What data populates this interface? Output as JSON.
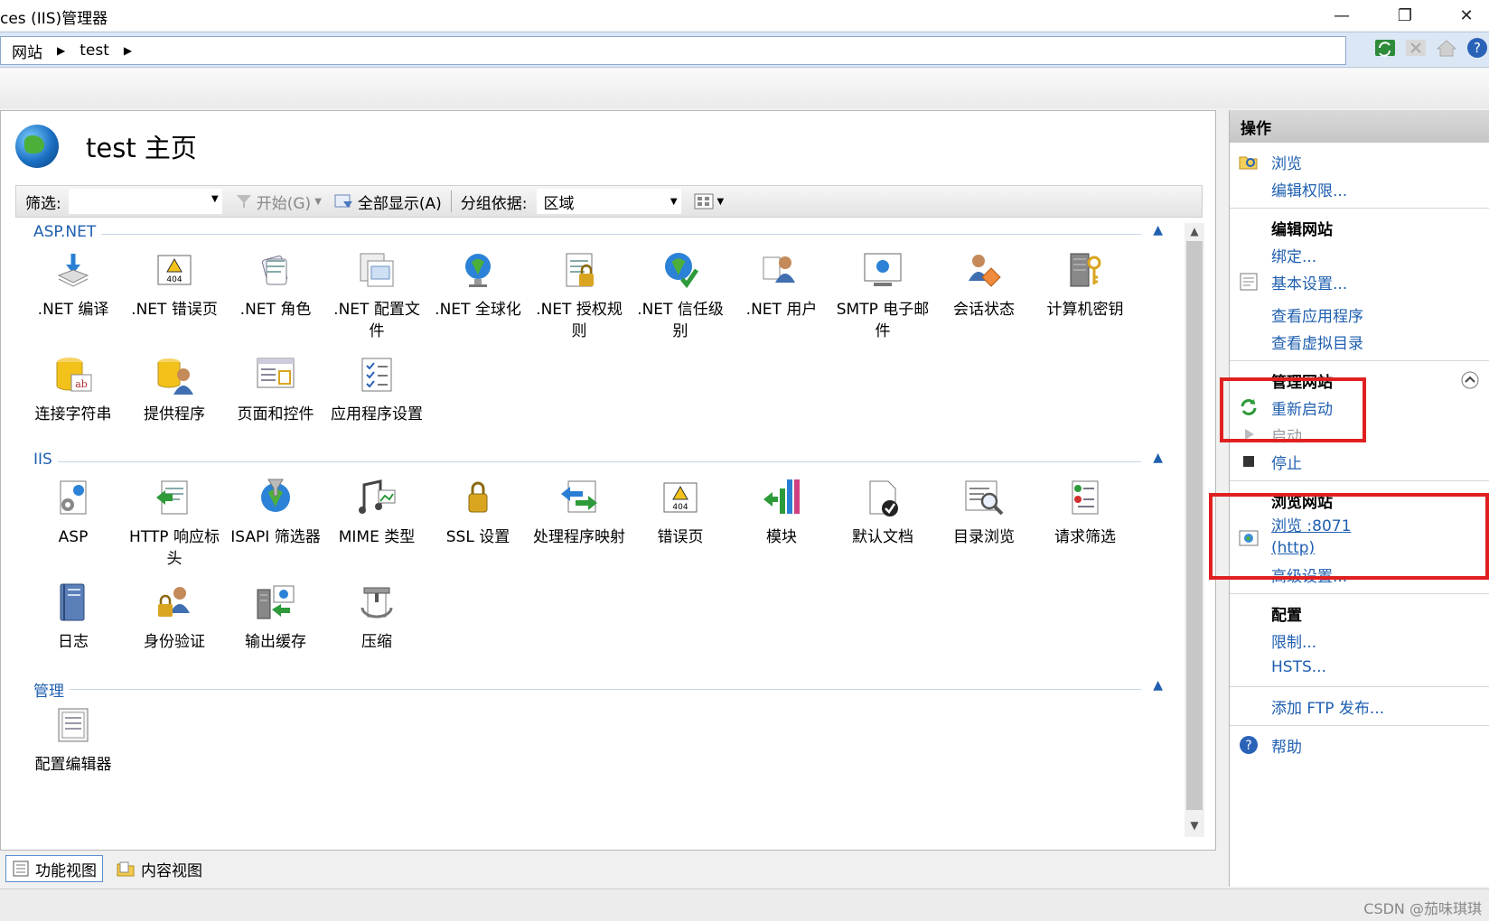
{
  "window": {
    "title": "ces (IIS)管理器",
    "minimize": "—",
    "restore": "❐",
    "close": "✕"
  },
  "address": {
    "crumbs": [
      "网站",
      "test"
    ]
  },
  "page": {
    "title": "test 主页"
  },
  "toolbar": {
    "filter_label": "筛选:",
    "start_label": "开始(G)",
    "show_all_label": "全部显示(A)",
    "group_label": "分组依据:",
    "group_value": "区域"
  },
  "sections": {
    "aspnet": {
      "name": "ASP.NET",
      "items": [
        {
          "label": ".NET 编译",
          "icon": "compile-icon"
        },
        {
          "label": ".NET 错误页",
          "icon": "error-page-icon"
        },
        {
          "label": ".NET 角色",
          "icon": "roles-icon"
        },
        {
          "label": ".NET 配置文件",
          "icon": "profile-icon"
        },
        {
          "label": ".NET 全球化",
          "icon": "globe-icon"
        },
        {
          "label": ".NET 授权规则",
          "icon": "authorization-icon"
        },
        {
          "label": ".NET 信任级别",
          "icon": "trust-icon"
        },
        {
          "label": ".NET 用户",
          "icon": "users-icon"
        },
        {
          "label": "SMTP 电子邮件",
          "icon": "smtp-icon"
        },
        {
          "label": "会话状态",
          "icon": "session-icon"
        },
        {
          "label": "计算机密钥",
          "icon": "machine-key-icon"
        },
        {
          "label": "连接字符串",
          "icon": "connection-string-icon"
        },
        {
          "label": "提供程序",
          "icon": "providers-icon"
        },
        {
          "label": "页面和控件",
          "icon": "pages-controls-icon"
        },
        {
          "label": "应用程序设置",
          "icon": "app-settings-icon"
        }
      ]
    },
    "iis": {
      "name": "IIS",
      "items": [
        {
          "label": "ASP",
          "icon": "asp-icon"
        },
        {
          "label": "HTTP 响应标头",
          "icon": "http-headers-icon"
        },
        {
          "label": "ISAPI 筛选器",
          "icon": "isapi-icon"
        },
        {
          "label": "MIME 类型",
          "icon": "mime-icon"
        },
        {
          "label": "SSL 设置",
          "icon": "ssl-lock-icon"
        },
        {
          "label": "处理程序映射",
          "icon": "handler-icon"
        },
        {
          "label": "错误页",
          "icon": "error-page-icon"
        },
        {
          "label": "模块",
          "icon": "modules-icon"
        },
        {
          "label": "默认文档",
          "icon": "default-doc-icon"
        },
        {
          "label": "目录浏览",
          "icon": "directory-browse-icon"
        },
        {
          "label": "请求筛选",
          "icon": "request-filter-icon"
        },
        {
          "label": "日志",
          "icon": "logging-icon"
        },
        {
          "label": "身份验证",
          "icon": "authentication-icon"
        },
        {
          "label": "输出缓存",
          "icon": "output-cache-icon"
        },
        {
          "label": "压缩",
          "icon": "compression-icon"
        }
      ]
    },
    "manage": {
      "name": "管理",
      "items": [
        {
          "label": "配置编辑器",
          "icon": "config-editor-icon"
        }
      ]
    }
  },
  "bottom_tabs": {
    "features": "功能视图",
    "content": "内容视图"
  },
  "actions": {
    "header": "操作",
    "browse": "浏览",
    "edit_permissions": "编辑权限...",
    "edit_site_title": "编辑网站",
    "bindings": "绑定...",
    "basic_settings": "基本设置...",
    "view_apps": "查看应用程序",
    "view_vdirs": "查看虚拟目录",
    "manage_site_title": "管理网站",
    "restart": "重新启动",
    "start": "启动",
    "stop": "停止",
    "browse_site_title": "浏览网站",
    "browse_port": "浏览 :8071",
    "browse_http": "(http)",
    "advanced_settings": "高级设置...",
    "config_title": "配置",
    "limits": "限制...",
    "hsts": "HSTS...",
    "add_ftp": "添加 FTP 发布...",
    "help": "帮助"
  },
  "watermark": "CSDN @茄味琪琪",
  "colors": {
    "link": "#1f5fb0",
    "highlight_box": "#e02020"
  }
}
